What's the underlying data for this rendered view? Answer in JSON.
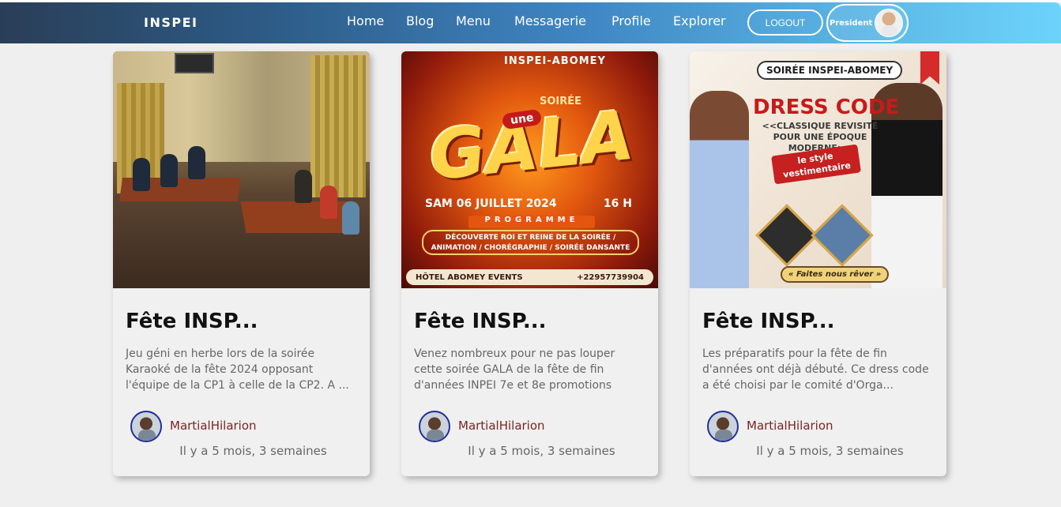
{
  "brand": "INSPEI",
  "nav": {
    "links": [
      "Home",
      "Blog",
      "Menu",
      "Messagerie",
      "Profile",
      "Explorer"
    ],
    "logout_label": "LOGOUT",
    "role_label": "President"
  },
  "cards": [
    {
      "title": "Fête INSP...",
      "description": "Jeu géni en herbe lors de la soirée Karaoké de la fête 2024 opposant l'équipe de la CP1 à celle de la CP2. A ...",
      "author": "MartialHilarion",
      "time": "Il y a 5 mois, 3 semaines"
    },
    {
      "title": "Fête INSP...",
      "description": "Venez nombreux pour ne pas louper cette soirée GALA de la fête de fin d'années INPEI 7e et 8e promotions",
      "author": "MartialHilarion",
      "time": "Il y a 5 mois, 3 semaines",
      "poster": {
        "header": "INSPEI-ABOMEY",
        "soiree": "SOIRÉE",
        "une": "une",
        "big": "GALA",
        "date": "SAM 06 JUILLET 2024",
        "hour": "16 H",
        "programme": "PROGRAMME",
        "program_text": "DÉCOUVERTE ROI ET REINE DE LA SOIRÉE / ANIMATION / CHORÉGRAPHIE / SOIRÉE DANSANTE",
        "venue": "HÔTEL ABOMEY EVENTS",
        "phone": "+22957739904"
      }
    },
    {
      "title": "Fête INSP...",
      "description": "Les préparatifs pour la fête de fin d'années ont déjà débuté. Ce dress code a été choisi par le comité d'Orga...",
      "author": "MartialHilarion",
      "time": "Il y a 5 mois, 3 semaines",
      "poster": {
        "header": "SOIRÉE INSPEI-ABOMEY",
        "big": "DRESS CODE",
        "sub": "<<CLASSIQUE REVISITÉ POUR UNE ÉPOQUE MODERNE>>",
        "ribbon": "le style vestimentaire",
        "tag": "« Faites nous rêver »"
      }
    }
  ]
}
